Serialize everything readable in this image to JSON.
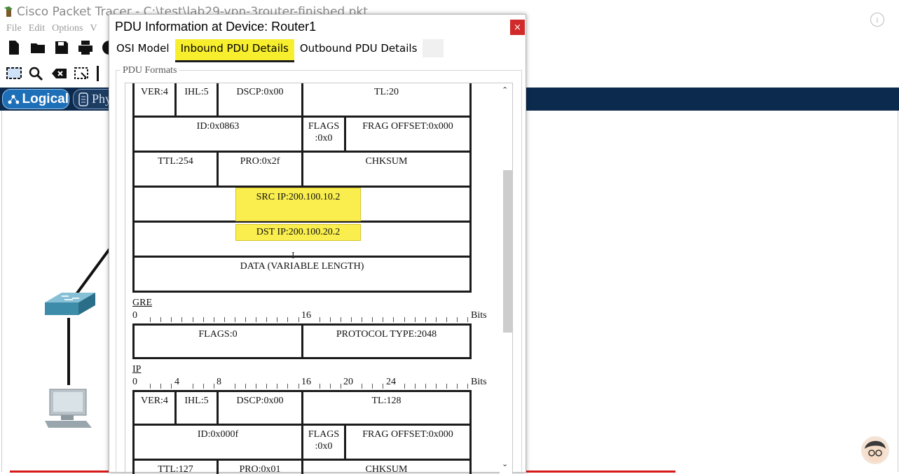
{
  "main_window": {
    "title": "Cisco Packet Tracer - C:\\test\\lab29-vpn-3router-finished.pkt",
    "menu": [
      "File",
      "Edit",
      "Options",
      "V"
    ],
    "logical_tab": "Logical",
    "physical_tab": "Phy",
    "info_icon": "i"
  },
  "dialog": {
    "title": "PDU Information at Device: Router1",
    "close_label": "×",
    "tabs": [
      {
        "label": "OSI Model",
        "active": false
      },
      {
        "label": "Inbound PDU Details",
        "active": true
      },
      {
        "label": "Outbound PDU Details",
        "active": false
      }
    ],
    "group_label": "PDU Formats",
    "outer_ip": {
      "row1": {
        "ver": "VER:4",
        "ihl": "IHL:5",
        "dscp": "DSCP:0x00",
        "tl": "TL:20"
      },
      "row2": {
        "id": "ID:0x0863",
        "flags": "FLAGS :0x0",
        "frag": "FRAG OFFSET:0x000"
      },
      "row3": {
        "ttl": "TTL:254",
        "pro": "PRO:0x2f",
        "chksum": "CHKSUM"
      },
      "src_ip": "SRC IP:200.100.10.2",
      "dst_ip": "DST IP:200.100.20.2",
      "data": "DATA (VARIABLE LENGTH)"
    },
    "gre": {
      "label": "GRE",
      "ruler_start": "0",
      "ruler_mid": "16",
      "ruler_unit": "Bits",
      "flags": "FLAGS:0",
      "protocol_type": "PROTOCOL TYPE:2048"
    },
    "inner_ip": {
      "label": "IP",
      "ruler": {
        "n0": "0",
        "n4": "4",
        "n8": "8",
        "n16": "16",
        "n20": "20",
        "n24": "24",
        "unit": "Bits"
      },
      "row1": {
        "ver": "VER:4",
        "ihl": "IHL:5",
        "dscp": "DSCP:0x00",
        "tl": "TL:128"
      },
      "row2": {
        "id": "ID:0x000f",
        "flags": "FLAGS :0x0",
        "frag": "FRAG OFFSET:0x000"
      },
      "row3": {
        "ttl": "TTL:127",
        "pro": "PRO:0x01",
        "chksum": "CHKSUM"
      }
    }
  }
}
